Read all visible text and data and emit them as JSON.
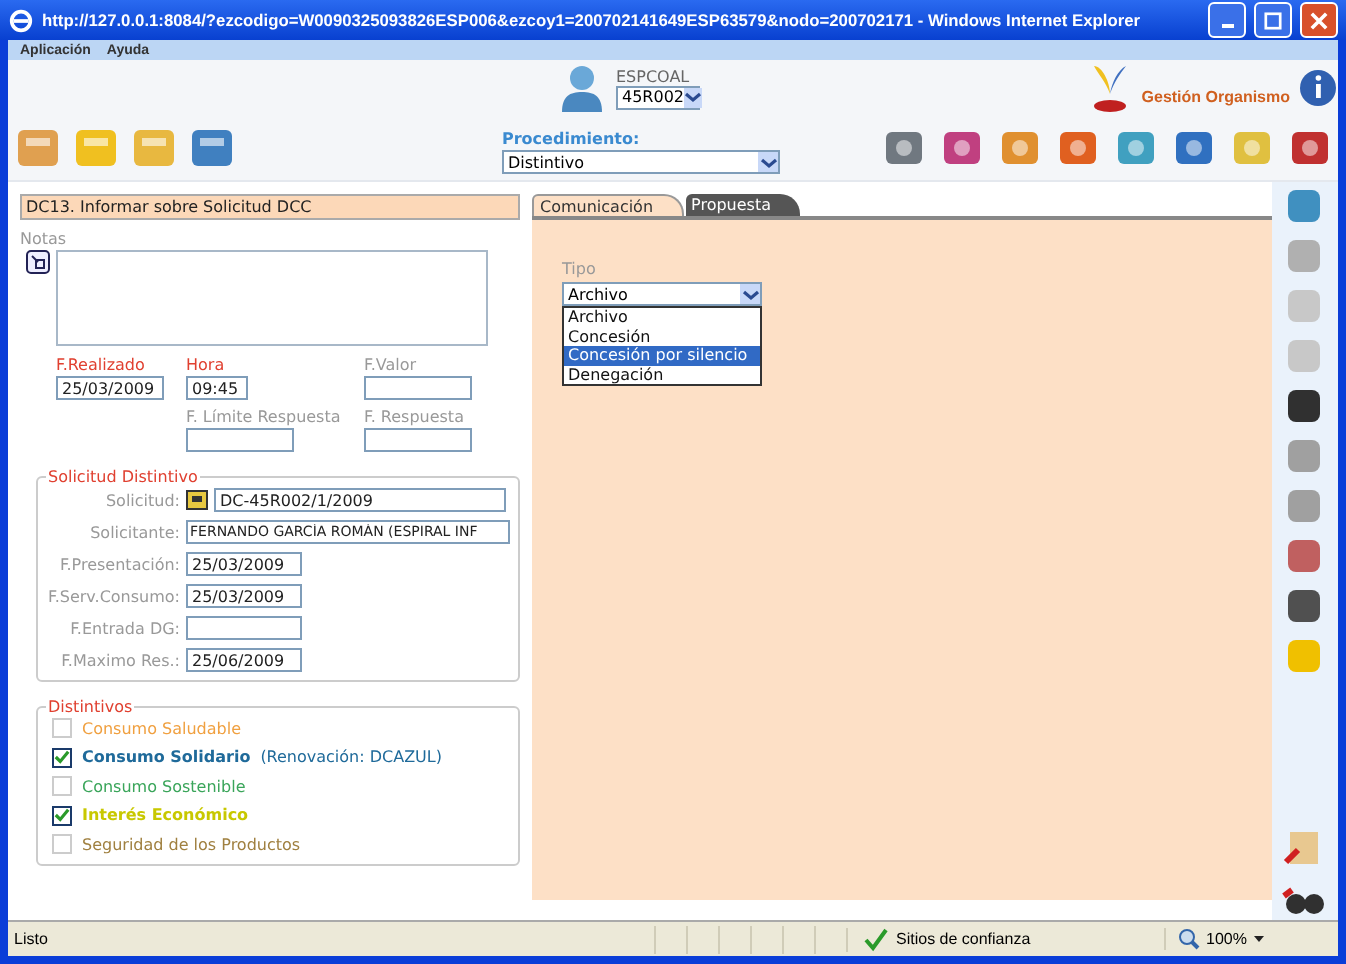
{
  "window": {
    "title": "http://127.0.0.1:8084/?ezcodigo=W0090325093826ESP006&ezcoy1=200702141649ESP63579&nodo=200702171 - Windows Internet Explorer"
  },
  "menu": [
    "Aplicación",
    "Ayuda"
  ],
  "header": {
    "user_label": "ESPCOAL",
    "user_select": "45R002",
    "brand": "Gestión Organismo"
  },
  "toolbar": {
    "procedure_label": "Procedimiento:",
    "procedure_select": "Distintivo"
  },
  "task": {
    "title": "DC13. Informar sobre Solicitud DCC",
    "notes_label": "Notas",
    "fields": [
      {
        "label": "F.Realizado",
        "value": "25/03/2009",
        "required": true,
        "kind": "date"
      },
      {
        "label": "Hora",
        "value": "09:45",
        "required": true,
        "kind": "time"
      },
      {
        "label": "F.Valor",
        "required": false,
        "kind": "date"
      },
      {
        "label": "F. Límite Respuesta",
        "required": false,
        "kind": "date"
      },
      {
        "label": "F. Respuesta",
        "required": false,
        "kind": "date"
      }
    ]
  },
  "solicitud": {
    "legend": "Solicitud Distintivo",
    "rows": [
      {
        "label": "Solicitud:",
        "value": "DC-45R002/1/2009",
        "kind": "lookup"
      },
      {
        "label": "Solicitante:",
        "value": "FERNANDO GARCÍA ROMÁN (ESPIRAL INF",
        "kind": "wide"
      },
      {
        "label": "F.Presentación:",
        "value": "25/03/2009",
        "kind": "date"
      },
      {
        "label": "F.Serv.Consumo:",
        "value": "25/03/2009",
        "kind": "date"
      },
      {
        "label": "F.Entrada DG:",
        "kind": "date"
      },
      {
        "label": "F.Maximo Res.:",
        "value": "25/06/2009",
        "kind": "date"
      }
    ]
  },
  "distintivos": {
    "legend": "Distintivos",
    "items": [
      {
        "label": "Consumo Saludable",
        "checked": false,
        "color": "#f0a040"
      },
      {
        "label": "Consumo Solidario",
        "checked": true,
        "color": "#1f6a9a",
        "note": "(Renovación: DCAZUL)"
      },
      {
        "label": "Consumo Sostenible",
        "checked": false,
        "color": "#3aa55a"
      },
      {
        "label": "Interés Económico",
        "checked": true,
        "color": "#c8c800"
      },
      {
        "label": "Seguridad de los Productos",
        "checked": false,
        "color": "#a08040"
      }
    ]
  },
  "tabs": [
    {
      "label": "Comunicación",
      "selected": true
    },
    {
      "label": "Propuesta",
      "selected": false
    }
  ],
  "tipo": {
    "label": "Tipo",
    "value": "Archivo",
    "options": [
      {
        "label": "Archivo",
        "highlighted": false
      },
      {
        "label": "Concesión",
        "highlighted": false
      },
      {
        "label": "Concesión por silencio",
        "highlighted": true
      },
      {
        "label": "Denegación",
        "highlighted": false
      }
    ]
  },
  "status_bar": {
    "status": "Listo",
    "zone": "Sitios de confianza",
    "zoom": "100%"
  }
}
